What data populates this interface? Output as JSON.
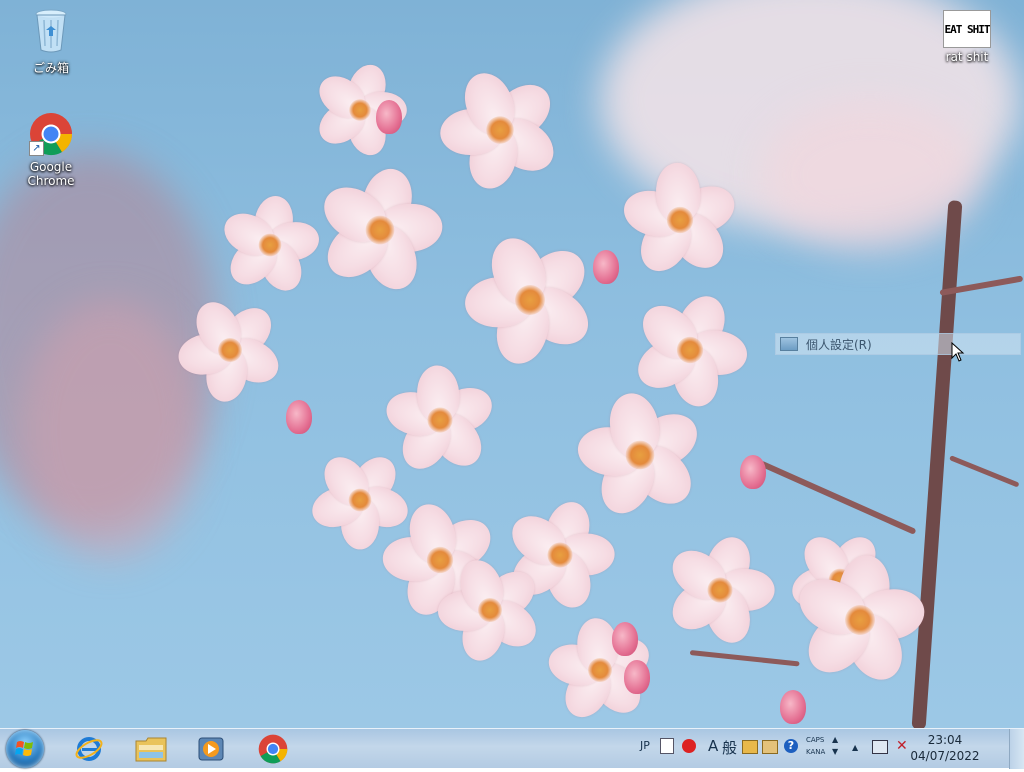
{
  "desktop": {
    "icons": [
      {
        "label": "ごみ箱",
        "icon": "recycle-bin-icon"
      },
      {
        "label": "Google Chrome",
        "icon": "chrome-icon"
      },
      {
        "label": "rat shit",
        "icon": "image-file-icon",
        "thumbnail_text": "EAT SHIT"
      }
    ],
    "context_item": {
      "label": "個人設定(R)"
    }
  },
  "taskbar": {
    "pinned": [
      {
        "name": "internet-explorer",
        "icon": "internet-explorer-icon"
      },
      {
        "name": "windows-explorer",
        "icon": "folder-icon"
      },
      {
        "name": "media-player",
        "icon": "media-player-icon"
      },
      {
        "name": "google-chrome",
        "icon": "chrome-icon"
      }
    ],
    "tray": {
      "language": "JP",
      "ime_mode": "A",
      "ime_kanji": "般",
      "caps": "CAPS",
      "kana": "KANA",
      "help": "?"
    },
    "clock": {
      "time": "23:04",
      "date": "04/07/2022"
    }
  },
  "colors": {
    "sky": "#8fbfe0",
    "petal": "#f6dde4",
    "stamen": "#e48a3c",
    "branch": "#6f4a4a",
    "taskbar": "#b3cbe3"
  }
}
